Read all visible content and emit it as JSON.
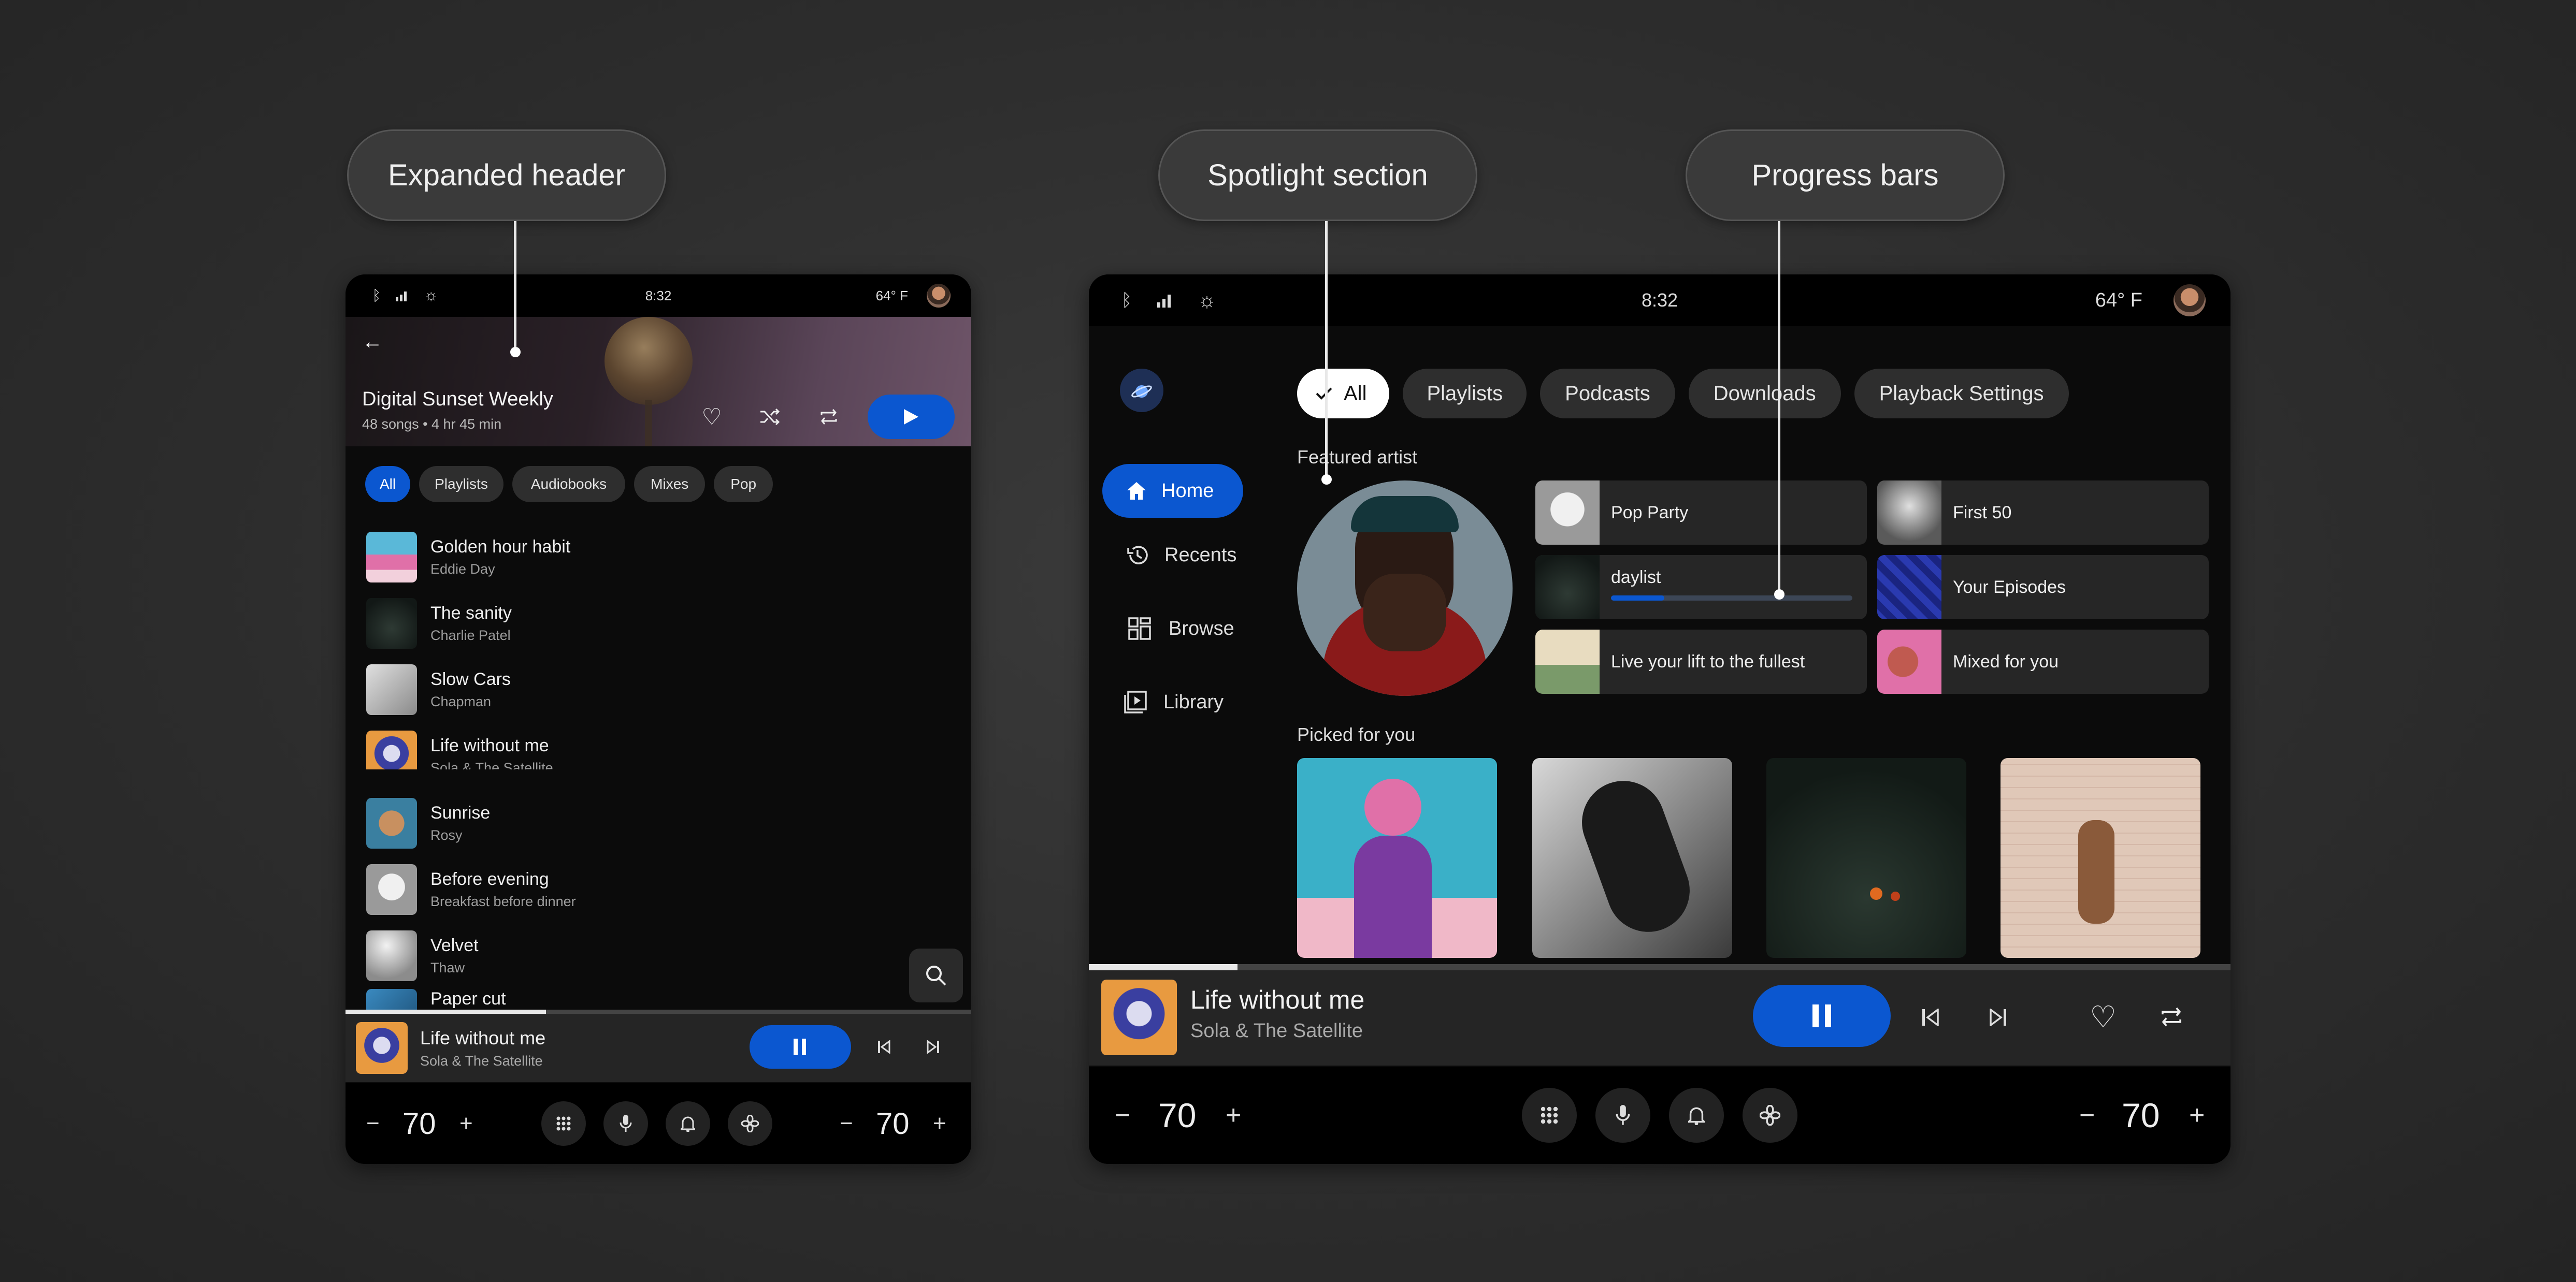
{
  "labels": {
    "expanded_header": "Expanded header",
    "spotlight": "Spotlight section",
    "progress": "Progress bars"
  },
  "left": {
    "status": {
      "time": "8:32",
      "temp": "64° F"
    },
    "header": {
      "title": "Digital Sunset Weekly",
      "meta": "48 songs • 4 hr 45 min"
    },
    "chips": [
      "All",
      "Playlists",
      "Audiobooks",
      "Mixes",
      "Pop"
    ],
    "tracks": [
      {
        "title": "Golden hour habit",
        "artist": "Eddie Day"
      },
      {
        "title": "The sanity",
        "artist": "Charlie Patel"
      },
      {
        "title": "Slow Cars",
        "artist": "Chapman"
      },
      {
        "title": "Life without me",
        "artist": "Sola & The Satellite"
      },
      {
        "title": "Sunrise",
        "artist": "Rosy"
      },
      {
        "title": "Before evening",
        "artist": "Breakfast before dinner"
      },
      {
        "title": "Velvet",
        "artist": "Thaw"
      },
      {
        "title": "Paper cut",
        "artist": ""
      }
    ],
    "now_playing": {
      "title": "Life without me",
      "artist": "Sola & The Satellite",
      "progress": 0.32
    },
    "climate": {
      "left_temp": "70",
      "right_temp": "70",
      "minus": "−",
      "plus": "+"
    }
  },
  "right": {
    "status": {
      "time": "8:32",
      "temp": "64° F"
    },
    "nav": [
      "Home",
      "Recents",
      "Browse",
      "Library"
    ],
    "chips": [
      "All",
      "Playlists",
      "Podcasts",
      "Downloads",
      "Playback Settings"
    ],
    "featured_label": "Featured artist",
    "cards": [
      {
        "title": "Pop Party"
      },
      {
        "title": "First 50"
      },
      {
        "title": "daylist",
        "progress": 0.22
      },
      {
        "title": "Your Episodes"
      },
      {
        "title": "Live your lift to the fullest"
      },
      {
        "title": "Mixed for you"
      }
    ],
    "picked_label": "Picked for you",
    "now_playing": {
      "title": "Life without me",
      "artist": "Sola & The Satellite",
      "progress": 0.13
    },
    "climate": {
      "left_temp": "70",
      "right_temp": "70",
      "minus": "−",
      "plus": "+"
    }
  },
  "colors": {
    "accent": "#0b57d0",
    "background": "#2c2c2c",
    "panel": "#0b0b0b"
  }
}
